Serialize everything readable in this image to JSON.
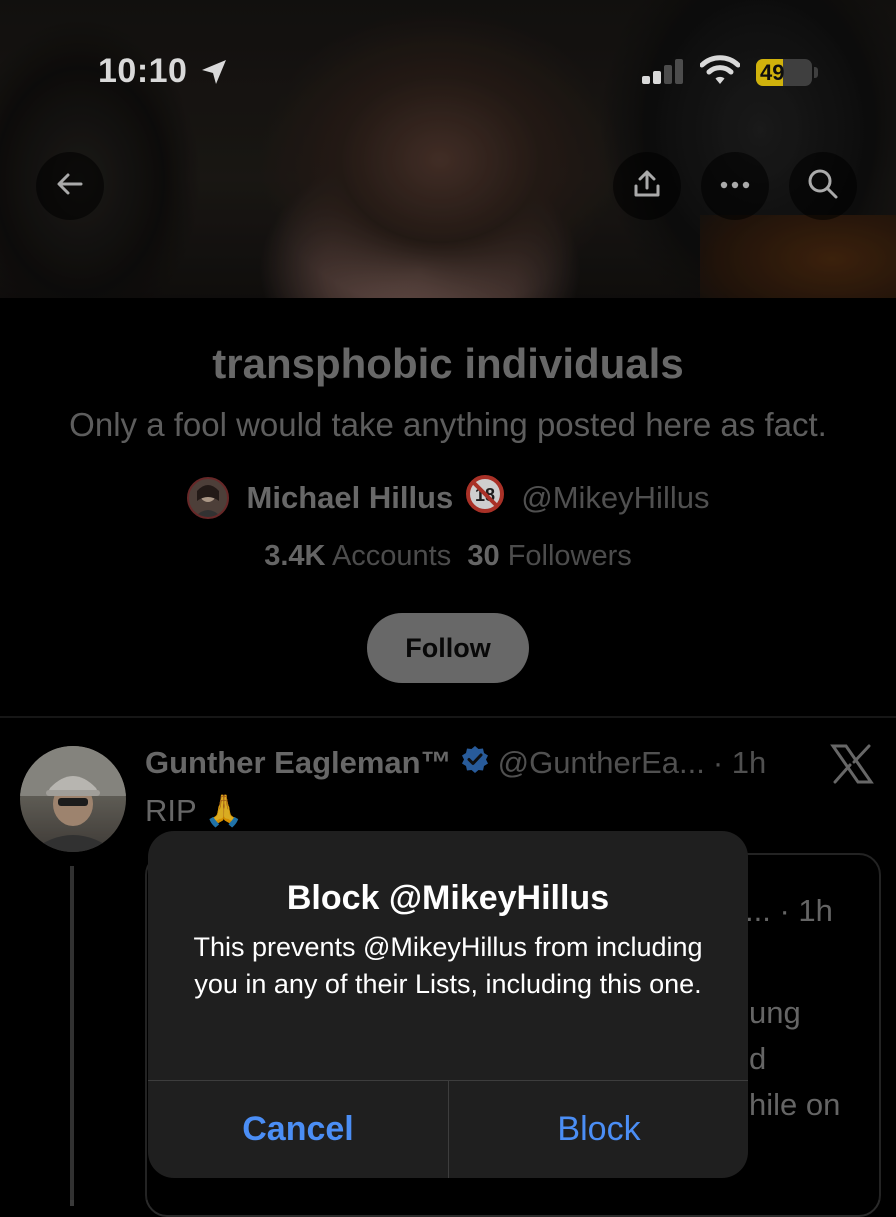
{
  "status_bar": {
    "time": "10:10",
    "battery": "49",
    "battery_level": 0.49,
    "battery_color": "#f5d20f"
  },
  "header": {
    "back_icon": "arrow-left-icon",
    "share_icon": "share-icon",
    "more_icon": "more-icon",
    "search_icon": "search-icon"
  },
  "list": {
    "title": "transphobic individuals",
    "description": "Only a fool would take anything posted here as fact.",
    "owner_name": "Michael Hillus",
    "owner_badge": "18",
    "owner_handle": "@MikeyHillus",
    "accounts_count": "3.4K",
    "accounts_label": "Accounts",
    "followers_count": "30",
    "followers_label": "Followers",
    "follow_label": "Follow"
  },
  "post": {
    "author_name": "Gunther Eagleman™",
    "author_handle": "@GuntherEa...",
    "time": "· 1h",
    "text": "RIP 🙏",
    "quote_time": "... · 1h",
    "quote_frag_1": "ung",
    "quote_frag_2": "d",
    "quote_frag_3": "hile on"
  },
  "dialog": {
    "title": "Block @MikeyHillus",
    "message": "This prevents @MikeyHillus from including you in any of their Lists, including this one.",
    "cancel_label": "Cancel",
    "block_label": "Block",
    "accent_color": "#4b8ef5"
  }
}
